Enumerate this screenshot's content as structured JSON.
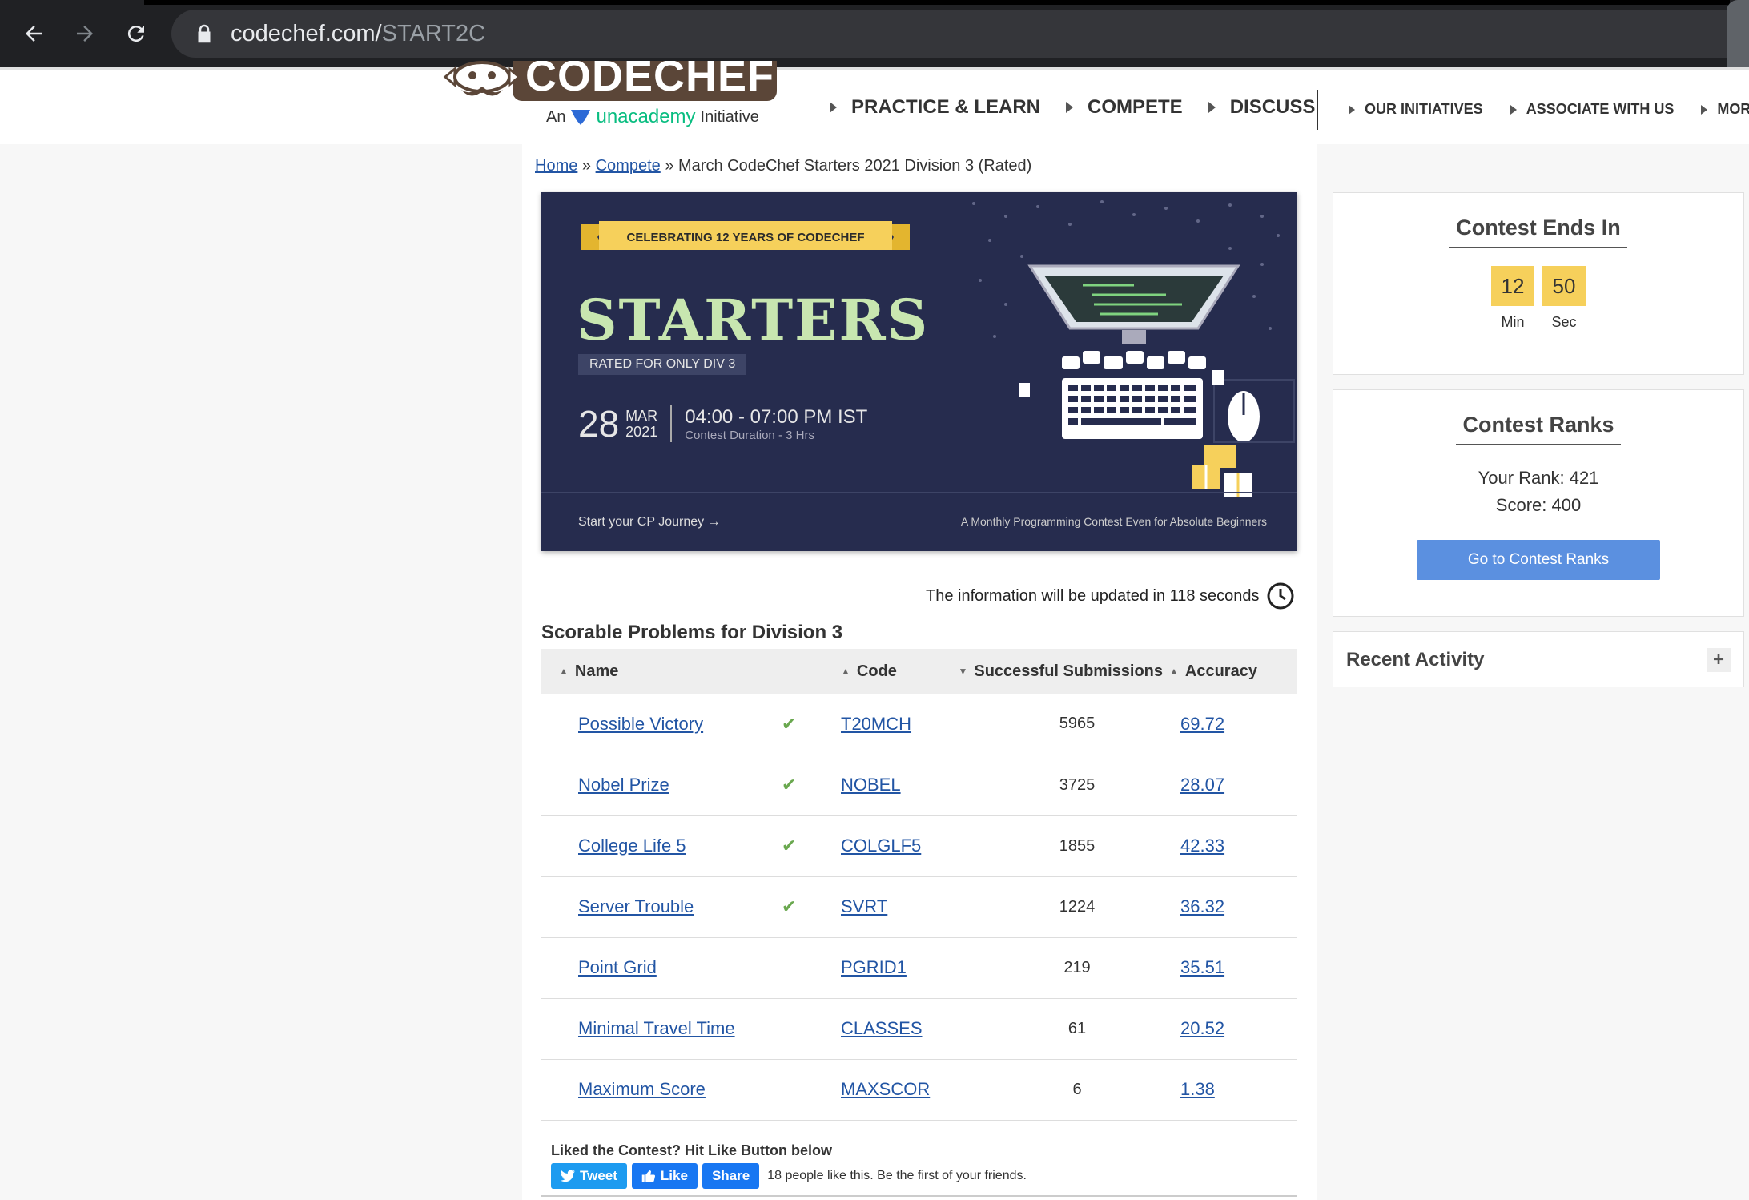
{
  "browser": {
    "url_host": "codechef.com/",
    "url_path": "START2C"
  },
  "header": {
    "logo_text": "CODECHEF",
    "logo_sub_an": "An",
    "logo_sub_brand": "unacademy",
    "logo_sub_initiative": "Initiative",
    "main_nav": [
      "PRACTICE & LEARN",
      "COMPETE",
      "DISCUSS"
    ],
    "sub_nav": [
      "OUR INITIATIVES",
      "ASSOCIATE WITH US",
      "MORE"
    ]
  },
  "breadcrumb": {
    "home": "Home",
    "sep": "»",
    "compete": "Compete",
    "current": "March CodeChef Starters 2021 Division 3 (Rated)"
  },
  "banner": {
    "ribbon": "CELEBRATING 12 YEARS OF CODECHEF",
    "title": "STARTERS",
    "rated": "RATED FOR ONLY DIV 3",
    "day": "28",
    "month": "MAR",
    "year": "2021",
    "time": "04:00 - 07:00 PM IST",
    "duration": "Contest Duration - 3 Hrs",
    "journey": "Start your CP Journey",
    "tagline": "A Monthly Programming Contest Even for Absolute Beginners"
  },
  "update_info": "The information will be updated in 118 seconds",
  "problems": {
    "section_title": "Scorable Problems for Division 3",
    "headers": {
      "name": "Name",
      "code": "Code",
      "submissions": "Successful Submissions",
      "accuracy": "Accuracy"
    },
    "rows": [
      {
        "name": "Possible Victory",
        "solved": true,
        "code": "T20MCH",
        "submissions": "5965",
        "accuracy": "69.72"
      },
      {
        "name": "Nobel Prize",
        "solved": true,
        "code": "NOBEL",
        "submissions": "3725",
        "accuracy": "28.07"
      },
      {
        "name": "College Life 5",
        "solved": true,
        "code": "COLGLF5",
        "submissions": "1855",
        "accuracy": "42.33"
      },
      {
        "name": "Server Trouble",
        "solved": true,
        "code": "SVRT",
        "submissions": "1224",
        "accuracy": "36.32"
      },
      {
        "name": "Point Grid",
        "solved": false,
        "code": "PGRID1",
        "submissions": "219",
        "accuracy": "35.51"
      },
      {
        "name": "Minimal Travel Time",
        "solved": false,
        "code": "CLASSES",
        "submissions": "61",
        "accuracy": "20.52"
      },
      {
        "name": "Maximum Score",
        "solved": false,
        "code": "MAXSCOR",
        "submissions": "6",
        "accuracy": "1.38"
      }
    ]
  },
  "social": {
    "prompt": "Liked the Contest? Hit Like Button below",
    "tweet": "Tweet",
    "like": "Like",
    "share": "Share",
    "likes_text": "18 people like this. Be the first of your friends."
  },
  "sidebar": {
    "ends_title": "Contest Ends In",
    "minutes": "12",
    "seconds": "50",
    "min_label": "Min",
    "sec_label": "Sec",
    "ranks_title": "Contest Ranks",
    "your_rank": "Your Rank: 421",
    "score": "Score: 400",
    "ranks_button": "Go to Contest Ranks",
    "recent_title": "Recent Activity",
    "recent_toggle": "+"
  },
  "colors": {
    "link": "#2255a4",
    "timer": "#f6d05b",
    "button": "#5b90e0",
    "banner_bg": "#262c4e",
    "solved_check": "#6aa84f"
  }
}
